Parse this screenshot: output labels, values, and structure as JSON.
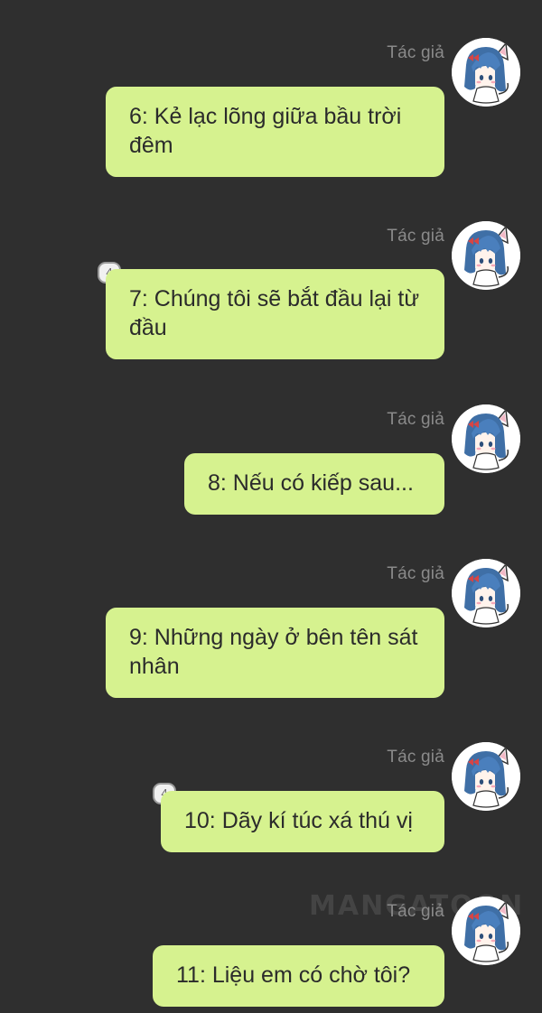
{
  "watermark": "MANGATOON",
  "messages": [
    {
      "author": "Tác giả",
      "text": "6: Kẻ lạc lõng giữa bầu trời đêm",
      "badge": null
    },
    {
      "author": "Tác giả",
      "text": "7: Chúng tôi sẽ bắt đầu lại từ đầu",
      "badge": "4"
    },
    {
      "author": "Tác giả",
      "text": "8: Nếu có kiếp sau...",
      "badge": null
    },
    {
      "author": "Tác giả",
      "text": "9: Những ngày ở bên tên sát nhân",
      "badge": null
    },
    {
      "author": "Tác giả",
      "text": "10: Dãy kí túc xá thú vị",
      "badge": "4"
    },
    {
      "author": "Tác giả",
      "text": "11: Liệu em có chờ tôi?",
      "badge": null
    }
  ],
  "colors": {
    "background": "#2f2f2f",
    "bubble": "#d6f28f",
    "author_label": "#8a8a8a",
    "text": "#2b2b2b"
  },
  "icons": {
    "avatar": "anime-cat-girl-avatar-icon",
    "badge": "comment-count-badge"
  }
}
